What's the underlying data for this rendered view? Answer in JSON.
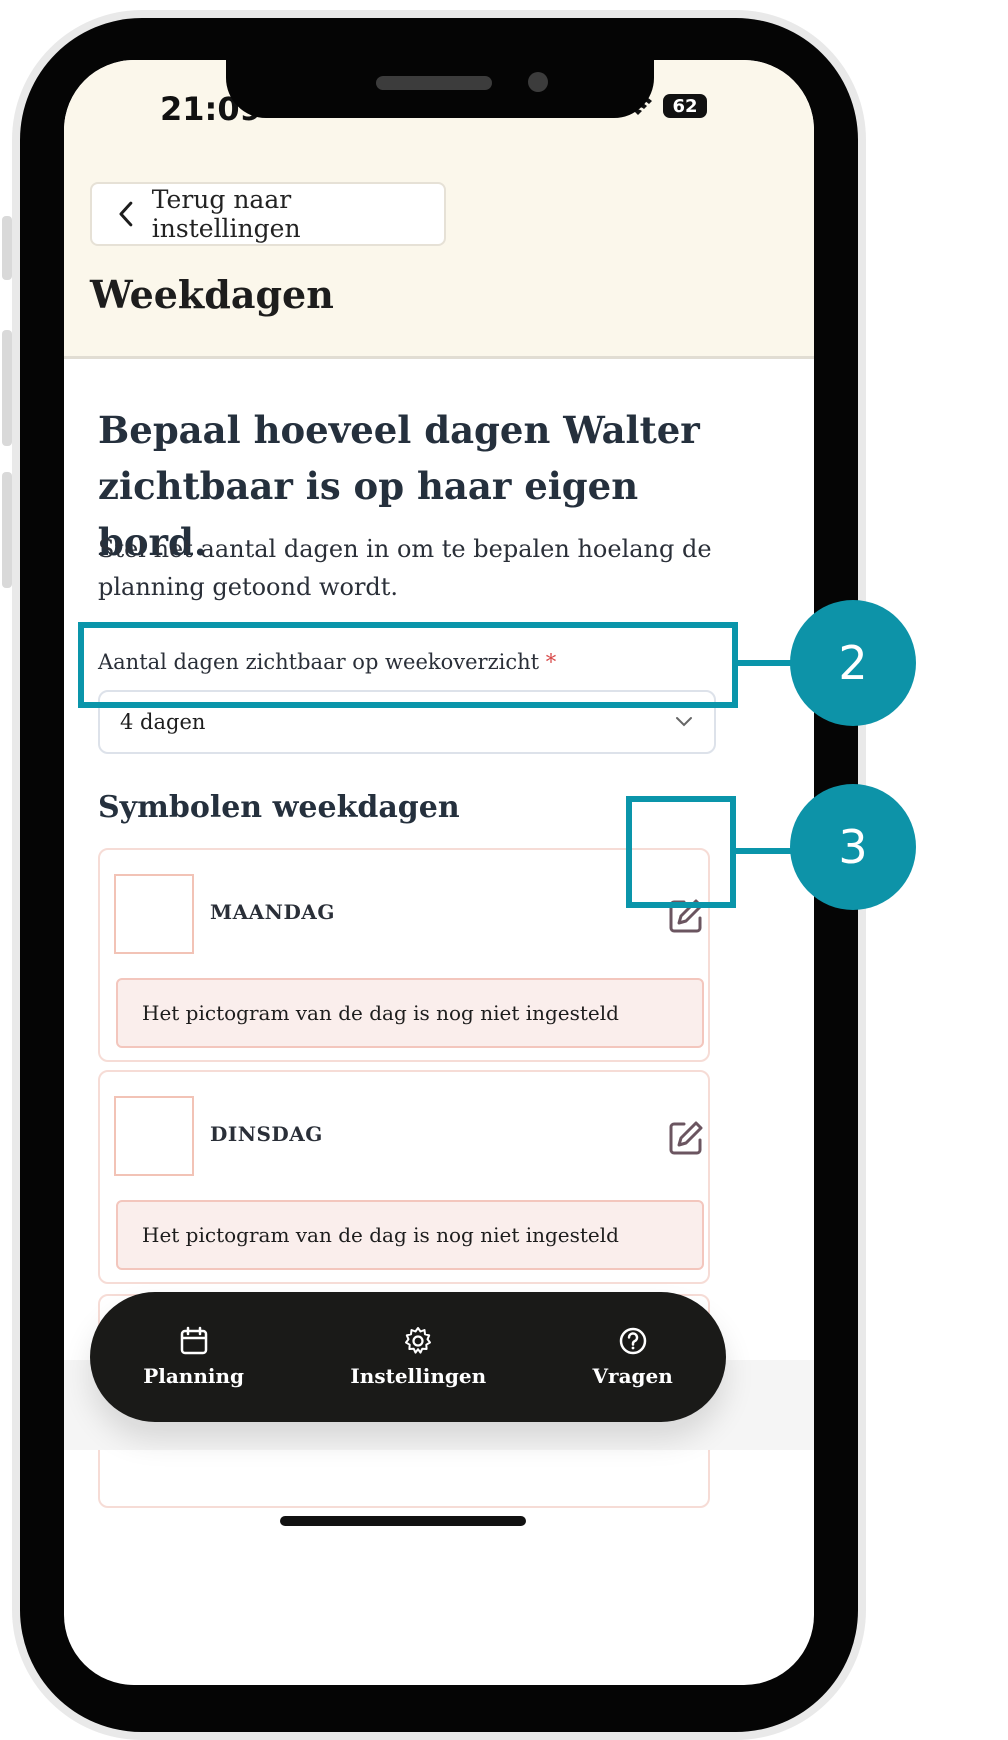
{
  "status_bar": {
    "time": "21:09",
    "battery": "62"
  },
  "header": {
    "back_label": "Terug naar instellingen",
    "title": "Weekdagen"
  },
  "intro": {
    "heading": "Bepaal hoeveel dagen Walter zichtbaar is op haar eigen bord.",
    "description": "Stel het aantal dagen in om te bepalen hoelang de planning getoond wordt."
  },
  "days_field": {
    "label": "Aantal dagen zichtbaar op weekoverzicht",
    "required_marker": "*",
    "value": "4 dagen"
  },
  "symbols": {
    "title": "Symbolen weekdagen",
    "days": [
      {
        "name": "MAANDAG",
        "note": "Het pictogram van de dag is nog niet ingesteld"
      },
      {
        "name": "DINSDAG",
        "note": "Het pictogram van de dag is nog niet ingesteld"
      }
    ]
  },
  "bottom_nav": [
    {
      "label": "Planning",
      "icon": "calendar-icon"
    },
    {
      "label": "Instellingen",
      "icon": "gear-icon"
    },
    {
      "label": "Vragen",
      "icon": "question-icon"
    }
  ],
  "annotations": [
    {
      "number": "2"
    },
    {
      "number": "3"
    }
  ],
  "colors": {
    "header_bg": "#fbf7eb",
    "annotation": "#0d93a8",
    "nav_bg": "#1a1a18",
    "warning_bg": "#faeeec"
  }
}
